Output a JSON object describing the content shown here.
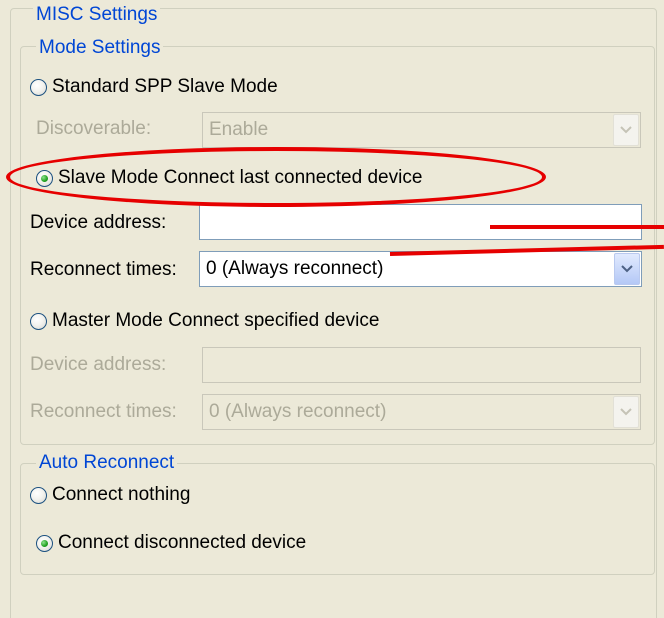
{
  "misc_settings": {
    "legend": "MISC Settings"
  },
  "mode_settings": {
    "legend": "Mode Settings",
    "standard_spp": {
      "label": "Standard SPP Slave Mode",
      "checked": false,
      "discoverable_label": "Discoverable:",
      "discoverable_value": "Enable"
    },
    "slave_connect_last": {
      "label": "Slave Mode Connect last connected device",
      "checked": true,
      "device_address_label": "Device address:",
      "device_address_value": "",
      "reconnect_times_label": "Reconnect times:",
      "reconnect_times_value": "0 (Always reconnect)"
    },
    "master_connect": {
      "label": "Master Mode Connect specified device",
      "checked": false,
      "device_address_label": "Device address:",
      "device_address_value": "",
      "reconnect_times_label": "Reconnect times:",
      "reconnect_times_value": "0 (Always reconnect)"
    }
  },
  "auto_reconnect": {
    "legend": "Auto Reconnect",
    "connect_nothing": {
      "label": "Connect nothing",
      "checked": false
    },
    "connect_disconnected": {
      "label": "Connect disconnected device",
      "checked": true
    }
  },
  "colors": {
    "legend_text": "#0046d5",
    "annotation_red": "#e60000",
    "disabled_text": "#acaa99",
    "background": "#ece9d8"
  },
  "icons": {
    "radio": "radio-button-icon",
    "dropdown": "chevron-down-icon"
  }
}
